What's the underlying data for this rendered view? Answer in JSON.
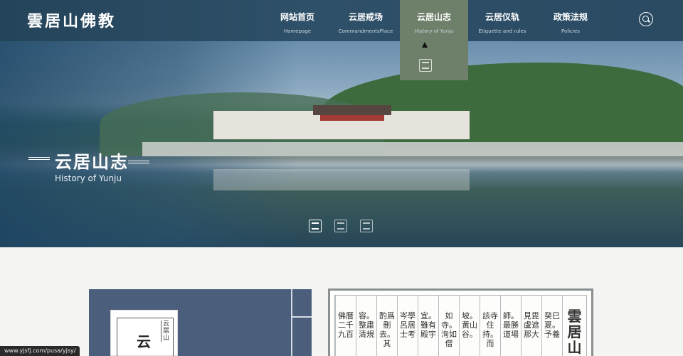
{
  "header": {
    "logo": "雲居山佛教",
    "nav": [
      {
        "zh": "网站首页",
        "en": "Homepage"
      },
      {
        "zh": "云居戒场",
        "en": "CommandmentsPlace"
      },
      {
        "zh": "云居山志",
        "en": "History of Yunju"
      },
      {
        "zh": "云居仪轨",
        "en": "Etiquette and rules"
      },
      {
        "zh": "政策法规",
        "en": "Policies"
      }
    ],
    "active_index": 2
  },
  "hero": {
    "title": "云居山志",
    "subtitle": "History of Yunju",
    "slides": 3,
    "active_slide": 0
  },
  "book": {
    "cover_title": "云",
    "cover_side": "云居山"
  },
  "scroll": {
    "title": "雲居山",
    "columns": [
      "癸巳夏。予養",
      "見毘盧遮那大",
      "師。最勝道場",
      "該寺住持。而",
      "坡。黃山谷。",
      "如寺。洵如僧",
      "宜。雖有殿宇",
      "岑學呂居士考",
      "酌爲刪去。其",
      "容。整肅清規",
      "佛曆二千九百"
    ]
  },
  "status_url": "www.yjsfj.com/pusa/yjsy/"
}
